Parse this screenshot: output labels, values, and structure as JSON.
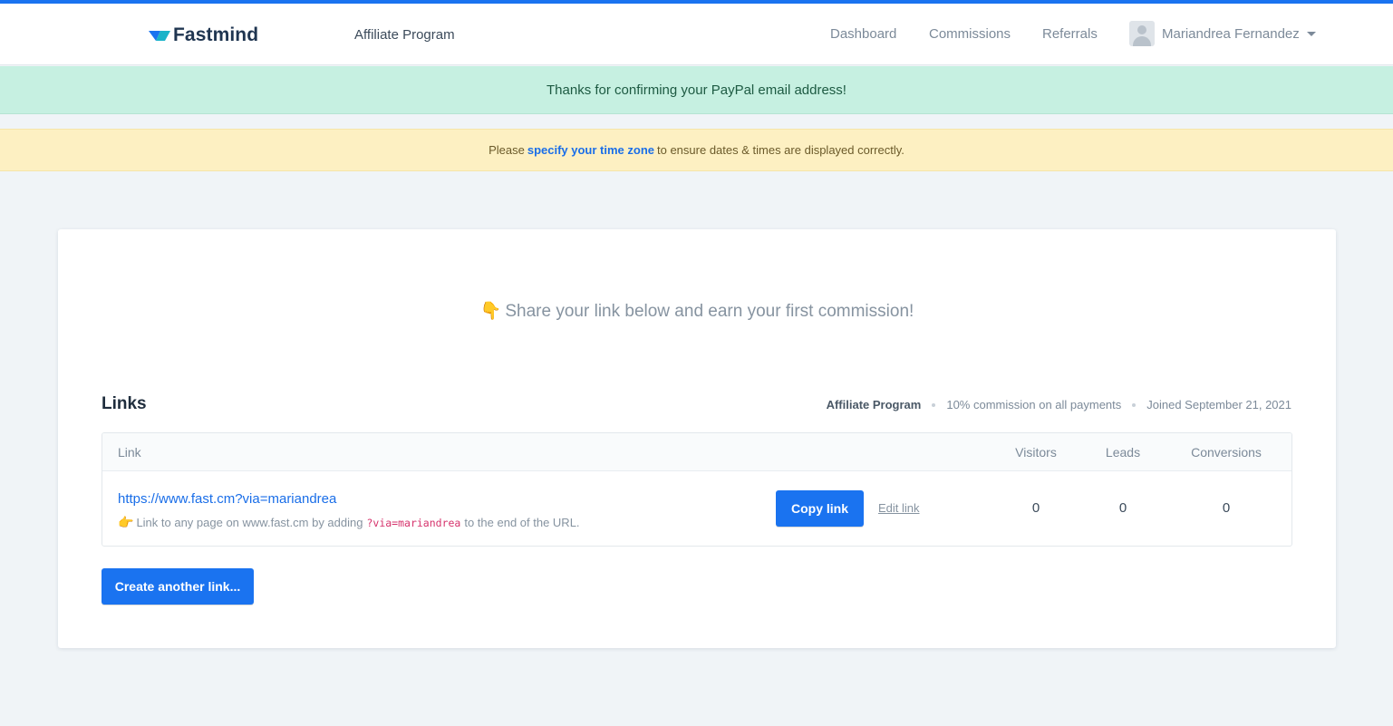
{
  "nav": {
    "brand": "Fastmind",
    "brand_icon": "fastmind-logo-icon",
    "program": "Affiliate Program",
    "links": {
      "dashboard": "Dashboard",
      "commissions": "Commissions",
      "referrals": "Referrals"
    },
    "user_name": "Mariandrea Fernandez"
  },
  "alerts": {
    "success": "Thanks for confirming your PayPal email address!",
    "warning_prefix": "Please",
    "warning_link": "specify your time zone",
    "warning_suffix": "to ensure dates & times are displayed correctly."
  },
  "hero": {
    "icon": "👇",
    "text": "Share your link below and earn your first commission!"
  },
  "links_section": {
    "title": "Links",
    "program": "Affiliate Program",
    "commission": "10% commission on all payments",
    "joined": "Joined September 21, 2021",
    "columns": {
      "link": "Link",
      "visitors": "Visitors",
      "leads": "Leads",
      "conversions": "Conversions"
    },
    "rows": [
      {
        "url": "https://www.fast.cm?via=mariandrea",
        "hint_icon": "👉",
        "hint_prefix": "Link to any page on www.fast.cm by adding",
        "hint_code": "?via=mariandrea",
        "hint_suffix": "to the end of the URL.",
        "copy_label": "Copy link",
        "edit_label": "Edit link",
        "visitors": "0",
        "leads": "0",
        "conversions": "0"
      }
    ],
    "create_label": "Create another link..."
  },
  "colors": {
    "accent": "#1a73f0",
    "success_bg": "#c6f0e1",
    "warning_bg": "#fdf0c2",
    "page_bg": "#f0f4f7"
  }
}
